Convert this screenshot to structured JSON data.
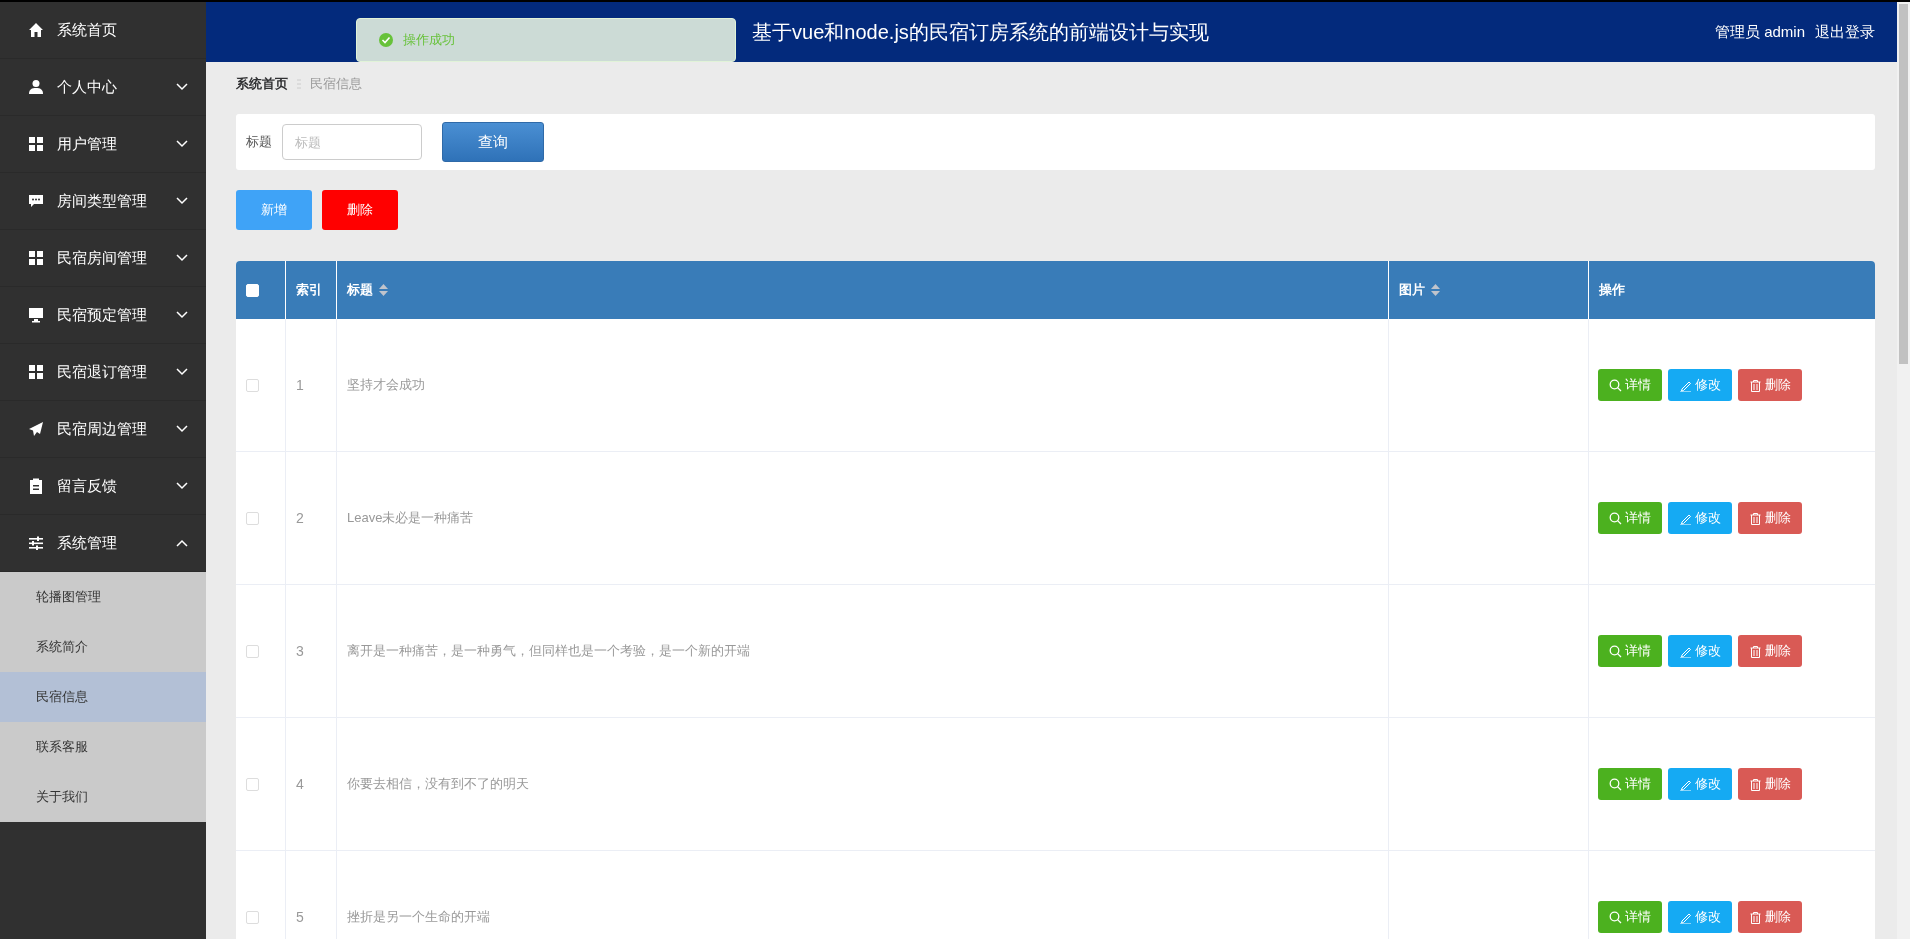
{
  "header": {
    "title": "基于vue和node.js的民宿订房系统的前端设计与实现",
    "user": "管理员 admin",
    "logout": "退出登录"
  },
  "toast": {
    "message": "操作成功"
  },
  "sidebar": {
    "items": [
      {
        "label": "系统首页",
        "has_children": false
      },
      {
        "label": "个人中心",
        "expanded": false,
        "has_children": true
      },
      {
        "label": "用户管理",
        "expanded": false,
        "has_children": true
      },
      {
        "label": "房间类型管理",
        "expanded": false,
        "has_children": true
      },
      {
        "label": "民宿房间管理",
        "expanded": false,
        "has_children": true
      },
      {
        "label": "民宿预定管理",
        "expanded": false,
        "has_children": true
      },
      {
        "label": "民宿退订管理",
        "expanded": false,
        "has_children": true
      },
      {
        "label": "民宿周边管理",
        "expanded": false,
        "has_children": true
      },
      {
        "label": "留言反馈",
        "expanded": false,
        "has_children": true
      },
      {
        "label": "系统管理",
        "expanded": true,
        "has_children": true,
        "children": [
          {
            "label": "轮播图管理",
            "selected": false
          },
          {
            "label": "系统简介",
            "selected": false
          },
          {
            "label": "民宿信息",
            "selected": true
          },
          {
            "label": "联系客服",
            "selected": false
          },
          {
            "label": "关于我们",
            "selected": false
          }
        ]
      }
    ]
  },
  "breadcrumb": [
    "系统首页",
    "民宿信息"
  ],
  "search": {
    "label": "标题",
    "placeholder": "标题",
    "button": "查询"
  },
  "toolbar": {
    "add": "新增",
    "delete": "删除"
  },
  "table": {
    "all_checked": false,
    "columns": [
      {
        "label": "索引",
        "sortable": false
      },
      {
        "label": "标题",
        "sortable": true
      },
      {
        "label": "图片",
        "sortable": true
      },
      {
        "label": "操作",
        "sortable": false
      }
    ],
    "rows": [
      {
        "checked": false,
        "index": "1",
        "title": "坚持才会成功",
        "actions": [
          {
            "kind": "detail",
            "label": "详情"
          },
          {
            "kind": "edit",
            "label": "修改"
          },
          {
            "kind": "delete",
            "label": "删除"
          }
        ]
      },
      {
        "checked": false,
        "index": "2",
        "title": "Leave未必是一种痛苦",
        "actions": [
          {
            "kind": "detail",
            "label": "详情"
          },
          {
            "kind": "edit",
            "label": "修改"
          },
          {
            "kind": "delete",
            "label": "删除"
          }
        ]
      },
      {
        "checked": false,
        "index": "3",
        "title": "离开是一种痛苦，是一种勇气，但同样也是一个考验，是一个新的开端",
        "actions": [
          {
            "kind": "detail",
            "label": "详情"
          },
          {
            "kind": "edit",
            "label": "修改"
          },
          {
            "kind": "delete",
            "label": "删除"
          }
        ]
      },
      {
        "checked": false,
        "index": "4",
        "title": "你要去相信，没有到不了的明天",
        "actions": [
          {
            "kind": "detail",
            "label": "详情"
          },
          {
            "kind": "edit",
            "label": "修改"
          },
          {
            "kind": "delete",
            "label": "删除"
          }
        ]
      },
      {
        "checked": false,
        "index": "5",
        "title": "挫折是另一个生命的开端",
        "actions": [
          {
            "kind": "detail",
            "label": "详情"
          },
          {
            "kind": "edit",
            "label": "修改"
          },
          {
            "kind": "delete",
            "label": "删除"
          }
        ]
      }
    ]
  }
}
